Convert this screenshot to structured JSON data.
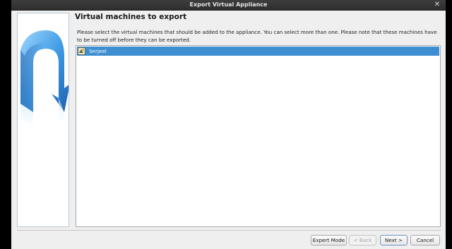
{
  "window": {
    "title": "Export Virtual Appliance"
  },
  "page": {
    "heading": "Virtual machines to export",
    "description": "Please select the virtual machines that should be added to the appliance. You can select more than one. Please note that these machines have to be turned off before they can be exported."
  },
  "vm_list": [
    {
      "name": "Serjeel",
      "selected": true
    }
  ],
  "buttons": {
    "expert_mode": "Expert Mode",
    "back": "< Back",
    "next": "Next >",
    "cancel": "Cancel"
  },
  "colors": {
    "selection": "#3d8fd1",
    "titlebar": "#333333",
    "window_bg": "#efefef"
  }
}
